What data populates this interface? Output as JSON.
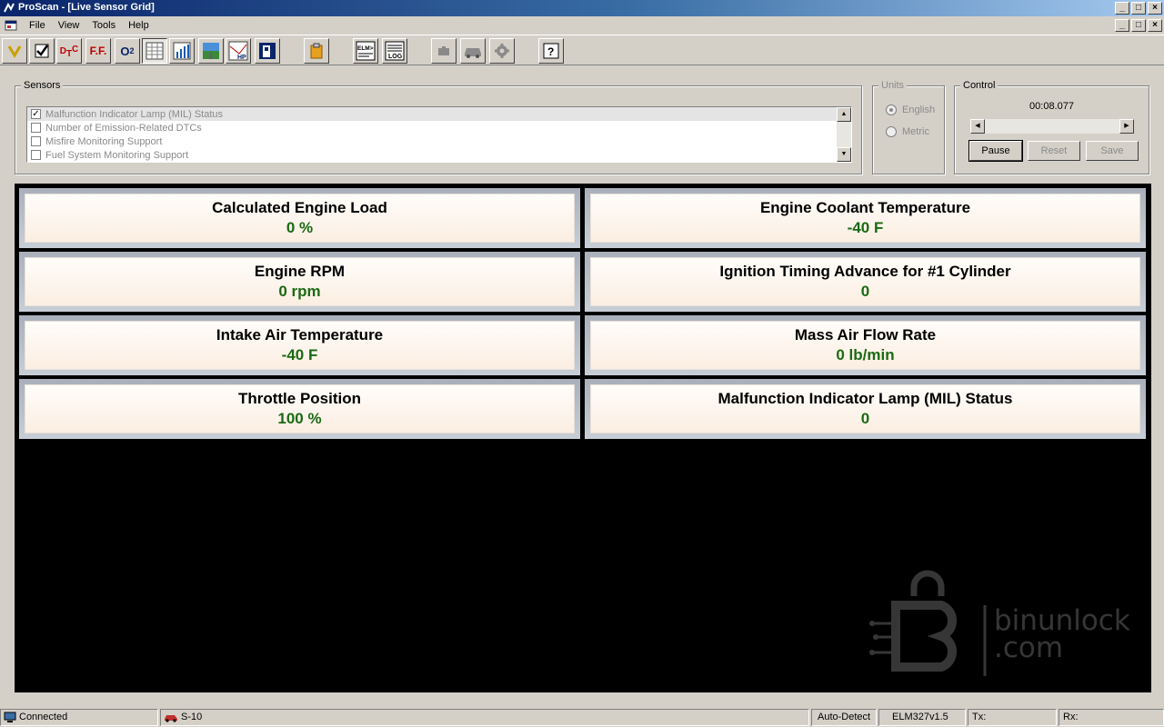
{
  "window": {
    "title": "ProScan - [Live Sensor Grid]",
    "buttons": [
      "_",
      "□",
      "×"
    ]
  },
  "menu": [
    "File",
    "View",
    "Tools",
    "Help"
  ],
  "toolbar": {
    "dtc": "DTC",
    "ff": "F.F.",
    "o2": "O2",
    "elm": "ELM",
    "log": "LOG",
    "hp": "HP",
    "help": "?"
  },
  "sensors": {
    "label": "Sensors",
    "items": [
      {
        "label": "Malfunction Indicator Lamp (MIL) Status",
        "checked": true
      },
      {
        "label": "Number of Emission-Related DTCs",
        "checked": false
      },
      {
        "label": "Misfire Monitoring Support",
        "checked": false
      },
      {
        "label": "Fuel System Monitoring Support",
        "checked": false
      }
    ]
  },
  "units": {
    "label": "Units",
    "english": "English",
    "metric": "Metric",
    "selected": "English"
  },
  "control": {
    "label": "Control",
    "timer": "00:08.077",
    "pause": "Pause",
    "reset": "Reset",
    "save": "Save"
  },
  "tiles": [
    {
      "label": "Calculated Engine Load",
      "value": "0 %"
    },
    {
      "label": "Engine Coolant Temperature",
      "value": "-40 F"
    },
    {
      "label": "Engine RPM",
      "value": "0 rpm"
    },
    {
      "label": "Ignition Timing Advance for #1 Cylinder",
      "value": "0"
    },
    {
      "label": "Intake Air Temperature",
      "value": "-40 F"
    },
    {
      "label": "Mass Air Flow Rate",
      "value": "0 lb/min"
    },
    {
      "label": "Throttle Position",
      "value": "100 %"
    },
    {
      "label": "Malfunction Indicator Lamp (MIL) Status",
      "value": "0"
    }
  ],
  "watermark": {
    "line1": "binunlock",
    "line2": ".com"
  },
  "status": {
    "connection": "Connected",
    "vehicle": "S-10",
    "protocol": "Auto-Detect",
    "interface": "ELM327v1.5",
    "tx": "Tx:",
    "rx": "Rx:"
  }
}
